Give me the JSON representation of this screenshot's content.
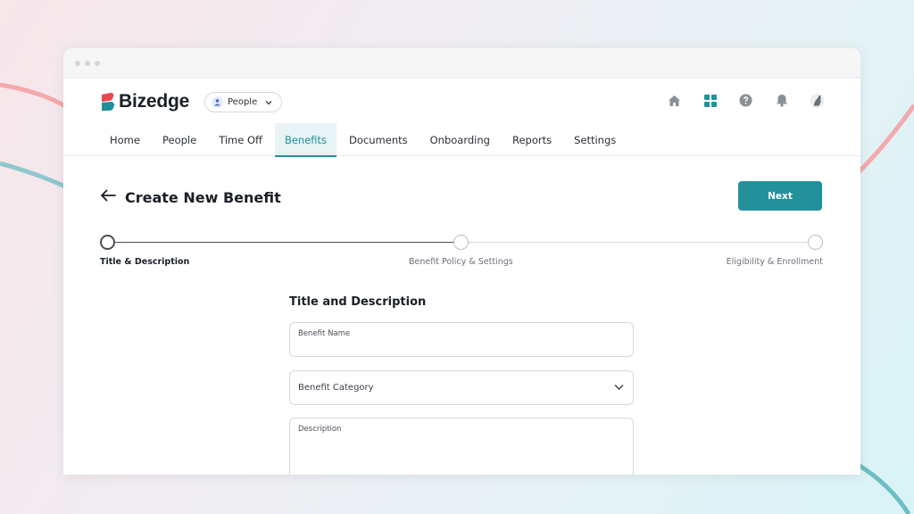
{
  "app": {
    "brand": "Bizedge",
    "module_selector": {
      "label": "People",
      "icon": "person-icon"
    },
    "top_icons": [
      "home-icon",
      "apps-grid-icon",
      "help-icon",
      "bell-icon",
      "user-avatar"
    ]
  },
  "nav": {
    "items": [
      {
        "label": "Home"
      },
      {
        "label": "People"
      },
      {
        "label": "Time Off"
      },
      {
        "label": "Benefits",
        "active": true
      },
      {
        "label": "Documents"
      },
      {
        "label": "Onboarding"
      },
      {
        "label": "Reports"
      },
      {
        "label": "Settings"
      }
    ]
  },
  "page": {
    "title": "Create New Benefit",
    "next_label": "Next"
  },
  "stepper": {
    "steps": [
      {
        "label": "Title & Description",
        "status": "current"
      },
      {
        "label": "Benefit Policy & Settings",
        "status": "upcoming"
      },
      {
        "label": "Eligibility & Enrollment",
        "status": "upcoming"
      }
    ]
  },
  "form": {
    "section_title": "Title and Description",
    "benefit_name": {
      "label": "Benefit Name",
      "value": ""
    },
    "benefit_category": {
      "label": "Benefit Category",
      "value": ""
    },
    "description": {
      "label": "Description",
      "value": ""
    }
  },
  "colors": {
    "accent": "#23919c",
    "accent_light": "#e7f3f5",
    "brand_red": "#e8474f",
    "brand_teal": "#1f8f9a"
  }
}
